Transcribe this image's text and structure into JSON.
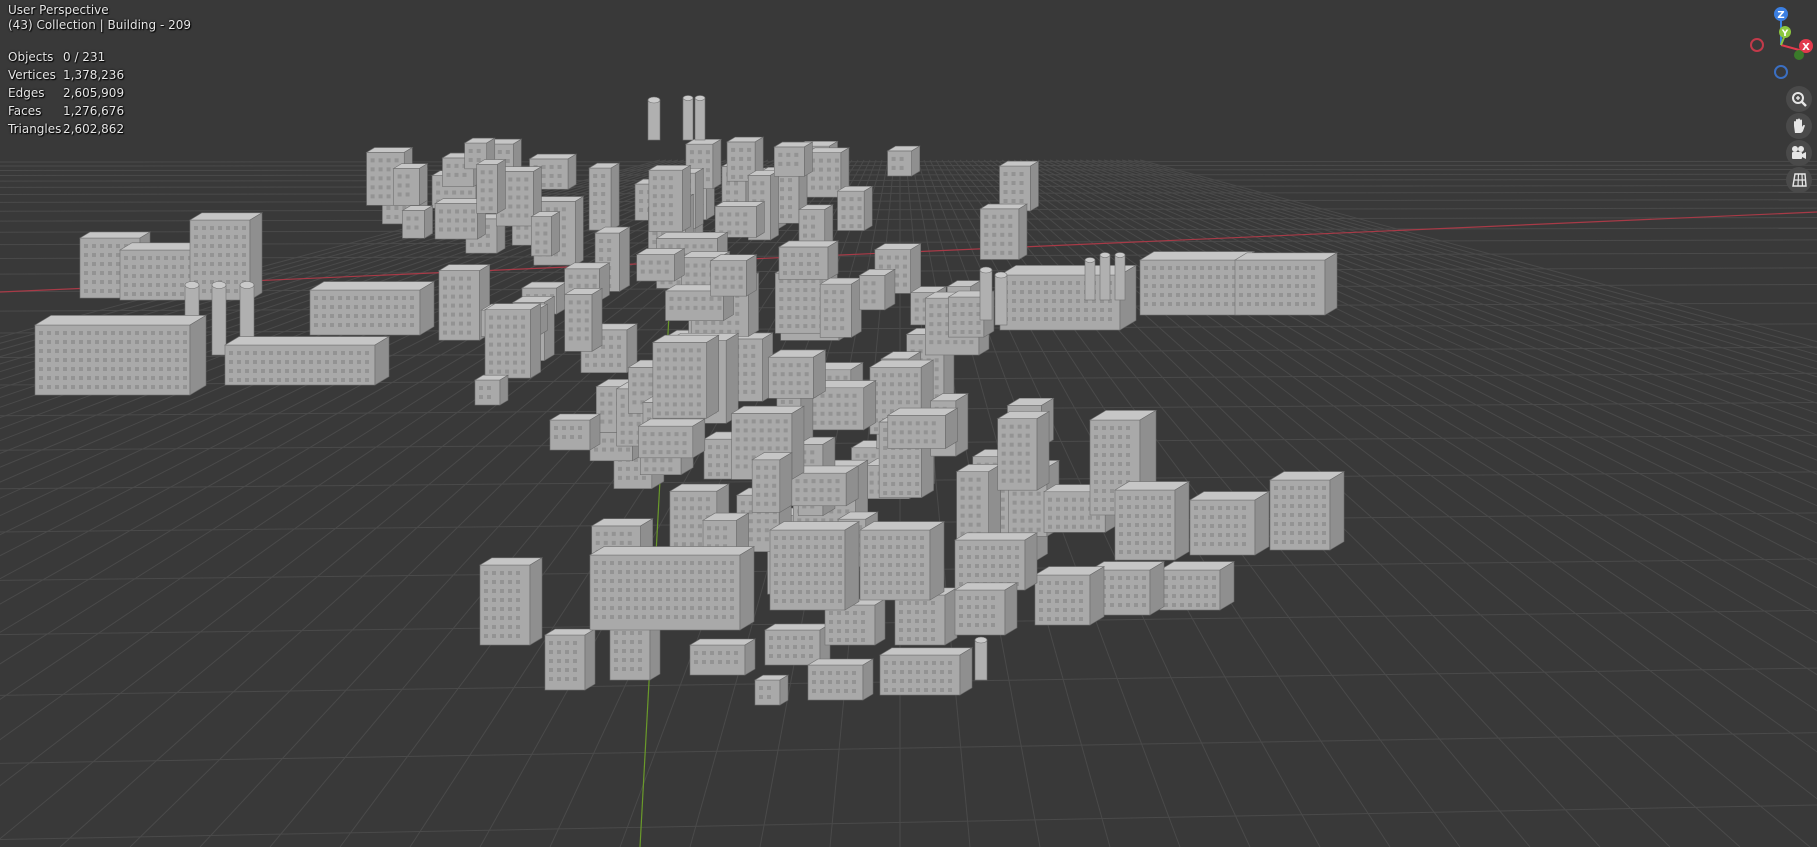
{
  "app": "Blender",
  "viewport": {
    "view_name": "User Perspective",
    "collection_line": "(43) Collection | Building - 209"
  },
  "statistics": [
    {
      "label": "Objects",
      "value": "0 / 231"
    },
    {
      "label": "Vertices",
      "value": "1,378,236"
    },
    {
      "label": "Edges",
      "value": "2,605,909"
    },
    {
      "label": "Faces",
      "value": "1,276,676"
    },
    {
      "label": "Triangles",
      "value": "2,602,862"
    }
  ],
  "gizmo": {
    "axes": [
      {
        "name": "X",
        "color": "#e23b4d"
      },
      {
        "name": "Y",
        "color": "#8bc63f"
      },
      {
        "name": "Z",
        "color": "#3b7fe2"
      }
    ]
  },
  "navigation_tools": [
    {
      "icon": "zoom-icon"
    },
    {
      "icon": "pan-hand-icon"
    },
    {
      "icon": "camera-icon"
    },
    {
      "icon": "grid-view-icon"
    }
  ],
  "colors": {
    "background": "#393939",
    "grid_line": "#4a4a4a",
    "x_axis": "#a83a47",
    "y_axis": "#6a9a2a",
    "model": "#b4b4b4"
  }
}
